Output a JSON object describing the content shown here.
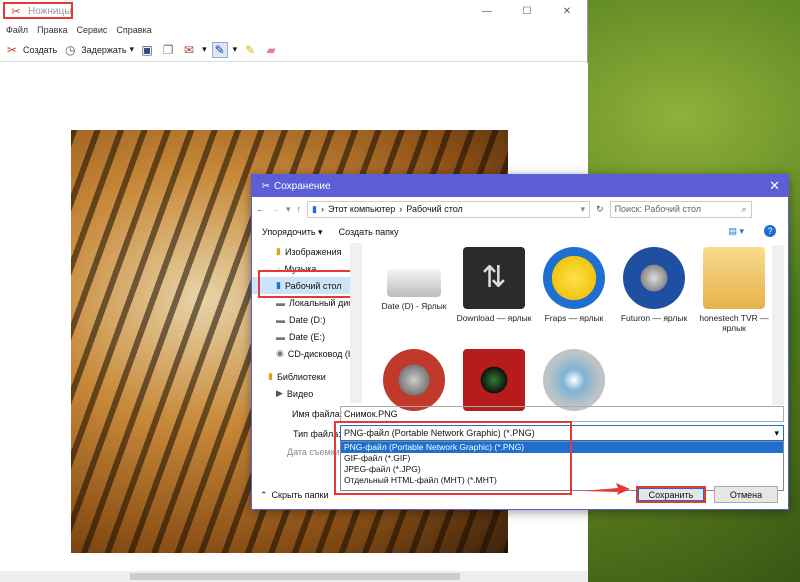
{
  "snip": {
    "title": "Ножницы",
    "controls": {
      "minimize": "—",
      "maximize": "☐",
      "close": "✕"
    },
    "menu": [
      "Файл",
      "Правка",
      "Сервис",
      "Справка"
    ],
    "toolbar": {
      "create_label": "Создать",
      "delay_label": "Задержать"
    }
  },
  "dialog": {
    "title": "Сохранение",
    "close": "✕",
    "breadcrumb": [
      "Этот компьютер",
      "Рабочий стол"
    ],
    "search_placeholder": "Поиск: Рабочий стол",
    "organize_label": "Упорядочить ▾",
    "new_folder_label": "Создать папку",
    "help": "?",
    "nav": [
      {
        "label": "Изображения",
        "icon": "pictures-icon"
      },
      {
        "label": "Музыка",
        "icon": "music-icon"
      },
      {
        "label": "Рабочий стол",
        "icon": "desktop-icon",
        "selected": true
      },
      {
        "label": "Локальный дис",
        "icon": "drive-icon"
      },
      {
        "label": "Date (D:)",
        "icon": "drive-icon"
      },
      {
        "label": "Date (E:)",
        "icon": "drive-icon"
      },
      {
        "label": "CD-дисковод (H",
        "icon": "cd-icon"
      },
      {
        "label": "Библиотеки",
        "icon": "library-icon"
      },
      {
        "label": "Видео",
        "icon": "video-icon"
      }
    ],
    "files": [
      {
        "label": "Date (D) - Ярлык",
        "icon": "drive-icon",
        "color": "#d9d9d9"
      },
      {
        "label": "Download — ярлык",
        "icon": "download-icon",
        "color": "#333333"
      },
      {
        "label": "Fraps — ярлык",
        "icon": "fraps-icon",
        "color": "#f1c40f"
      },
      {
        "label": "Futuron — ярлык",
        "icon": "futuron-icon",
        "color": "#1f4fa0"
      },
      {
        "label": "honestech TVR — ярлык",
        "icon": "folder-icon",
        "color": "#f2c25a"
      },
      {
        "label": "",
        "icon": "film-icon",
        "color": "#c0392b"
      },
      {
        "label": "",
        "icon": "camera-icon",
        "color": "#b71c1c"
      },
      {
        "label": "",
        "icon": "verbatim-icon",
        "color": "#7f8c8d"
      }
    ],
    "filename_label": "Имя файла:",
    "filename_value": "Снимок.PNG",
    "filetype_label": "Тип файла:",
    "filetype_value": "PNG-файл (Portable Network Graphic) (*.PNG)",
    "date_label": "Дата съемки:",
    "filetype_options": [
      "PNG-файл (Portable Network Graphic) (*.PNG)",
      "GIF-файл (*.GIF)",
      "JPEG-файл (*.JPG)",
      "Отдельный HTML-файл (MHT) (*.MHT)"
    ],
    "hide_folders": "Скрыть папки",
    "save": "Сохранить",
    "cancel": "Отмена"
  }
}
